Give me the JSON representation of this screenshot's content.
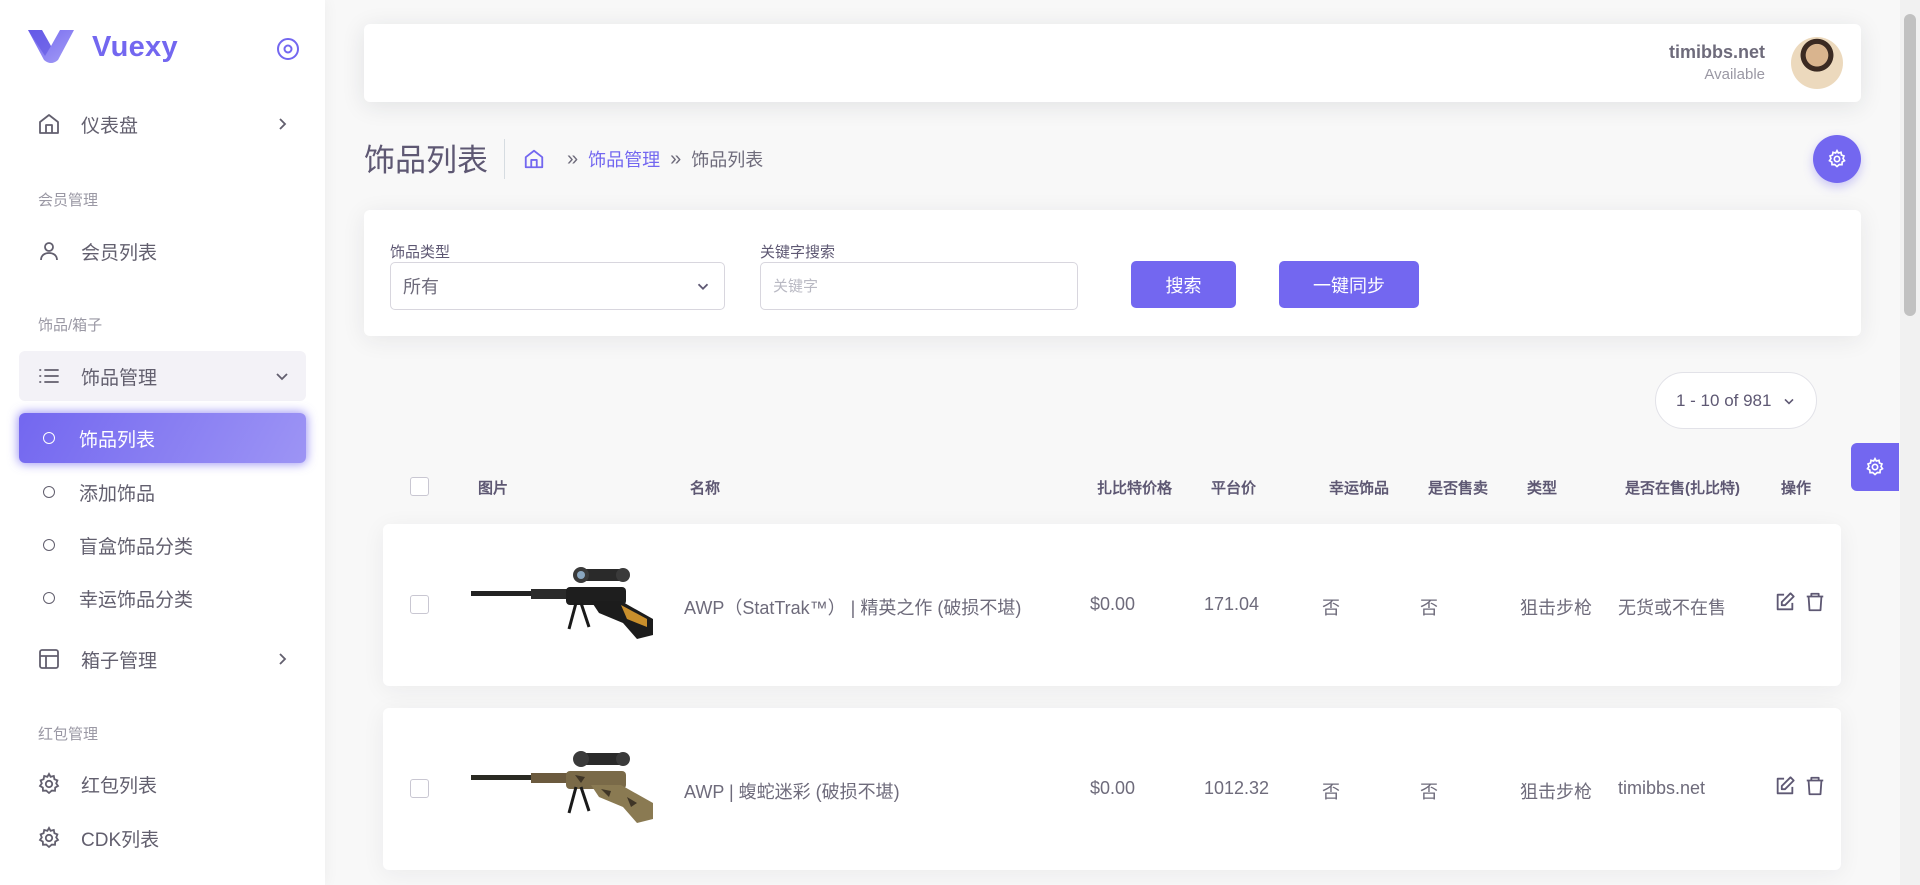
{
  "brand": {
    "name": "Vuexy",
    "color": "#7367f0"
  },
  "sidebar": {
    "dashboard": "仪表盘",
    "section_members": "会员管理",
    "member_list": "会员列表",
    "section_items": "饰品/箱子",
    "item_manage": "饰品管理",
    "item_list": "饰品列表",
    "add_item": "添加饰品",
    "blindbox_category": "盲盒饰品分类",
    "lucky_category": "幸运饰品分类",
    "box_manage": "箱子管理",
    "section_redpacket": "红包管理",
    "redpacket_list": "红包列表",
    "cdk_list": "CDK列表"
  },
  "navbar": {
    "user_name": "timibbs.net",
    "user_status": "Available"
  },
  "page": {
    "title": "饰品列表",
    "breadcrumb": {
      "parent": "饰品管理",
      "current": "饰品列表"
    }
  },
  "filters": {
    "type_label": "饰品类型",
    "type_value": "所有",
    "keyword_label": "关键字搜索",
    "keyword_placeholder": "关键字",
    "search_button": "搜索",
    "sync_button": "一键同步"
  },
  "pager": {
    "text": "1 - 10 of 981"
  },
  "table": {
    "headers": {
      "image": "图片",
      "name": "名称",
      "zbt_price": "扎比特价格",
      "platform_price": "平台价",
      "lucky": "幸运饰品",
      "for_sale": "是否售卖",
      "type": "类型",
      "on_sale_zbt": "是否在售(扎比特)",
      "actions": "操作"
    },
    "rows": [
      {
        "name": "AWP（StatTrak™） | 精英之作 (破损不堪)",
        "zbt_price": "$0.00",
        "platform_price": "171.04",
        "lucky": "否",
        "for_sale": "否",
        "type": "狙击步枪",
        "on_sale_zbt": "无货或不在售",
        "gun_style": "black"
      },
      {
        "name": "AWP | 蝮蛇迷彩 (破损不堪)",
        "zbt_price": "$0.00",
        "platform_price": "1012.32",
        "lucky": "否",
        "for_sale": "否",
        "type": "狙击步枪",
        "on_sale_zbt": "timibbs.net",
        "gun_style": "camo"
      }
    ]
  }
}
